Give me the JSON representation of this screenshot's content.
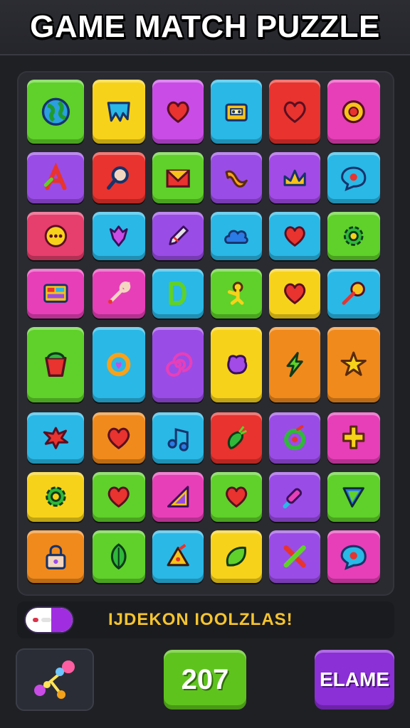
{
  "header": {
    "title": "GAME MATCH PUZZLE"
  },
  "board": {
    "rows": [
      [
        {
          "icon": "globe-icon",
          "color": "#5fd12a"
        },
        {
          "icon": "torn-flag-icon",
          "color": "#f7d21a"
        },
        {
          "icon": "heart-icon",
          "color": "#c94ce6"
        },
        {
          "icon": "cassette-icon",
          "color": "#2ab8e6"
        },
        {
          "icon": "heart-icon",
          "color": "#e8332e"
        },
        {
          "icon": "flower-icon",
          "color": "#e73fb8"
        }
      ],
      [
        {
          "icon": "letter-a-icon",
          "color": "#9a4ce6"
        },
        {
          "icon": "magnifier-icon",
          "color": "#e8332e"
        },
        {
          "icon": "envelope-icon",
          "color": "#5fd12a"
        },
        {
          "icon": "ribbon-icon",
          "color": "#9a4ce6"
        },
        {
          "icon": "crown-icon",
          "color": "#a24be6"
        },
        {
          "icon": "chat-bubble-icon",
          "color": "#2ab8e6"
        }
      ],
      [
        {
          "icon": "ellipsis-bubble-icon",
          "color": "#e63e6d"
        },
        {
          "icon": "gem-icon",
          "color": "#2ab8e6"
        },
        {
          "icon": "pencil-icon",
          "color": "#9a4ce6"
        },
        {
          "icon": "cloud-icon",
          "color": "#2ab8e6"
        },
        {
          "icon": "heart-icon",
          "color": "#2ab8e6"
        },
        {
          "icon": "gear-icon",
          "color": "#5fd12a"
        }
      ],
      [
        {
          "icon": "grid-panel-icon",
          "color": "#e73fb8"
        },
        {
          "icon": "wrench-icon",
          "color": "#e73fb8"
        },
        {
          "icon": "letter-d-icon",
          "color": "#2ab8e6"
        },
        {
          "icon": "figure-icon",
          "color": "#5fd12a"
        },
        {
          "icon": "heart-icon",
          "color": "#f7d21a"
        },
        {
          "icon": "key-icon",
          "color": "#2ab8e6"
        }
      ],
      [
        {
          "icon": "pot-icon",
          "color": "#5fd12a"
        },
        {
          "icon": "ring-icon",
          "color": "#2ab8e6"
        },
        {
          "icon": "spiral-icon",
          "color": "#9a4ce6"
        },
        {
          "icon": "blob-icon",
          "color": "#f7d21a"
        },
        {
          "icon": "lightning-icon",
          "color": "#f08a1c"
        },
        {
          "icon": "star-icon",
          "color": "#f08a1c"
        }
      ],
      [
        {
          "icon": "splat-icon",
          "color": "#2ab8e6"
        },
        {
          "icon": "heart-icon",
          "color": "#f08a1c"
        },
        {
          "icon": "music-note-icon",
          "color": "#2ab8e6"
        },
        {
          "icon": "carrot-icon",
          "color": "#e8332e"
        },
        {
          "icon": "donut-icon",
          "color": "#9a4ce6"
        },
        {
          "icon": "cross-shape-icon",
          "color": "#e73fb8"
        }
      ],
      [
        {
          "icon": "gear-icon",
          "color": "#f7d21a"
        },
        {
          "icon": "heart-icon",
          "color": "#5fd12a"
        },
        {
          "icon": "triangle-ruler-icon",
          "color": "#e73fb8"
        },
        {
          "icon": "heart-icon",
          "color": "#5fd12a"
        },
        {
          "icon": "brush-icon",
          "color": "#9a4ce6"
        },
        {
          "icon": "arrow-triangle-icon",
          "color": "#5fd12a"
        }
      ],
      [
        {
          "icon": "lock-icon",
          "color": "#f08a1c"
        },
        {
          "icon": "leaf-icon",
          "color": "#5fd12a"
        },
        {
          "icon": "cheese-icon",
          "color": "#2ab8e6"
        },
        {
          "icon": "leaf-blob-icon",
          "color": "#f7d21a"
        },
        {
          "icon": "x-icon",
          "color": "#9a4ce6"
        },
        {
          "icon": "chat-bubble-icon",
          "color": "#e73fb8"
        }
      ]
    ]
  },
  "status": {
    "message": "IJDEKON IOOLZLAS!"
  },
  "controls": {
    "tool_icon": "molecule-icon",
    "score": "207",
    "game_label": "ELAME"
  }
}
